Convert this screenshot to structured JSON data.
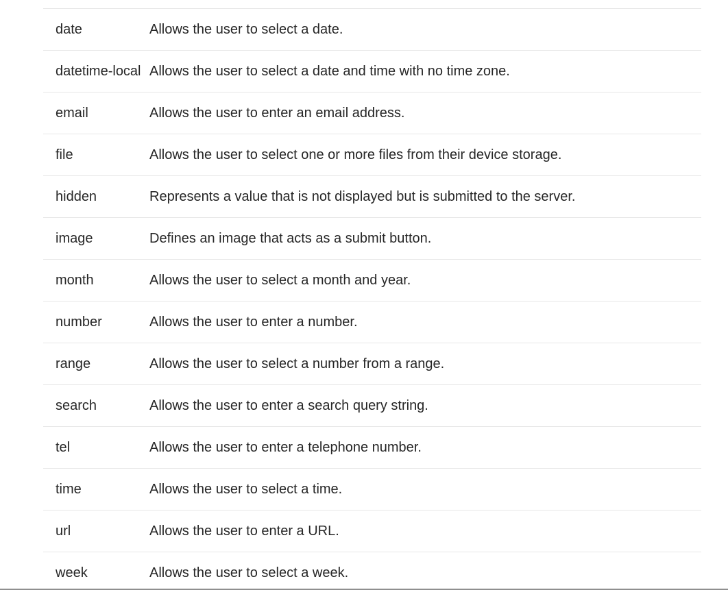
{
  "input_types_table": {
    "rows": [
      {
        "type": "date",
        "description": "Allows the user to select a date."
      },
      {
        "type": "datetime-local",
        "description": "Allows the user to select a date and time with no time zone."
      },
      {
        "type": "email",
        "description": "Allows the user to enter an email address."
      },
      {
        "type": "file",
        "description": "Allows the user to select one or more files from their device storage."
      },
      {
        "type": "hidden",
        "description": "Represents a value that is not displayed but is submitted to the server."
      },
      {
        "type": "image",
        "description": "Defines an image that acts as a submit button."
      },
      {
        "type": "month",
        "description": "Allows the user to select a month and year."
      },
      {
        "type": "number",
        "description": "Allows the user to enter a number."
      },
      {
        "type": "range",
        "description": "Allows the user to select a number from a range."
      },
      {
        "type": "search",
        "description": "Allows the user to enter a search query string."
      },
      {
        "type": "tel",
        "description": "Allows the user to enter a telephone number."
      },
      {
        "type": "time",
        "description": "Allows the user to select a time."
      },
      {
        "type": "url",
        "description": "Allows the user to enter a URL."
      },
      {
        "type": "week",
        "description": "Allows the user to select a week."
      }
    ]
  }
}
